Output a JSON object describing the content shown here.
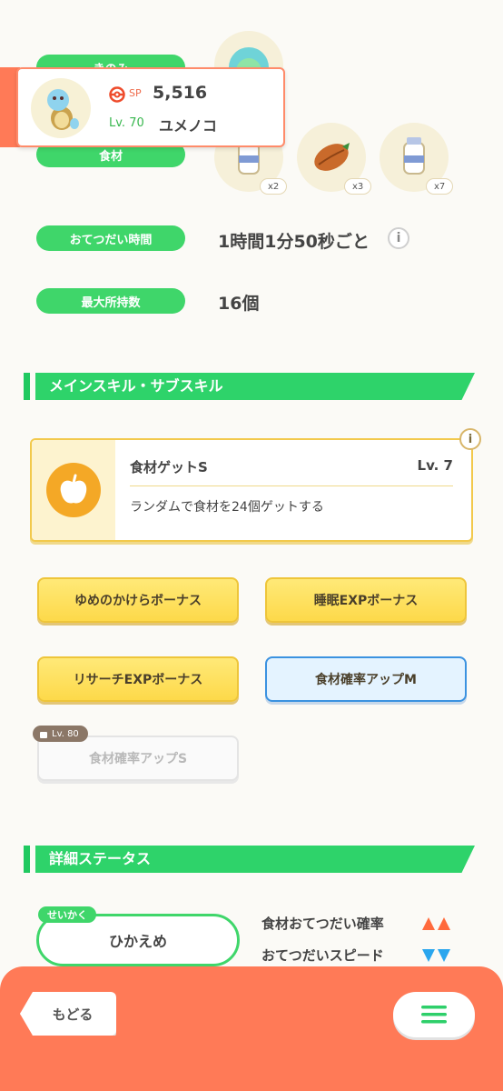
{
  "header_card": {
    "sp_label": "SP",
    "sp_value": "5,516",
    "level": "Lv. 70",
    "nickname": "ユメノコ"
  },
  "berry": {
    "label": "きのみ"
  },
  "ingredients": {
    "label": "食材",
    "items": [
      {
        "name": "milk-bottle",
        "count": "x2"
      },
      {
        "name": "cacao-bean",
        "count": "x3"
      },
      {
        "name": "milk-bottle",
        "count": "x7"
      }
    ]
  },
  "help_time": {
    "label": "おてつだい時間",
    "value": "1時間1分50秒ごと"
  },
  "max_carry": {
    "label": "最大所持数",
    "value": "16個"
  },
  "skill_section": {
    "title": "メインスキル・サブスキル",
    "main_skill": {
      "name": "食材ゲットS",
      "level": "Lv. 7",
      "description": "ランダムで食材を24個ゲットする"
    },
    "sub_skills": [
      {
        "label": "ゆめのかけらボーナス"
      },
      {
        "label": "睡眠EXPボーナス"
      },
      {
        "label": "リサーチEXPボーナス"
      },
      {
        "label": "食材確率アップM"
      },
      {
        "label": "食材確率アップS",
        "lock_level": "Lv. 80"
      }
    ]
  },
  "status_section": {
    "title": "詳細ステータス",
    "nature_tag": "せいかく",
    "nature": "ひかえめ",
    "up_stat": "食材おてつだい確率",
    "down_stat": "おてつだいスピード",
    "colors": {
      "up": "#ff6a3c",
      "down": "#2aa6ee"
    }
  },
  "footer": {
    "back_label": "もどる",
    "menu_icon": "hamburger-icon"
  }
}
